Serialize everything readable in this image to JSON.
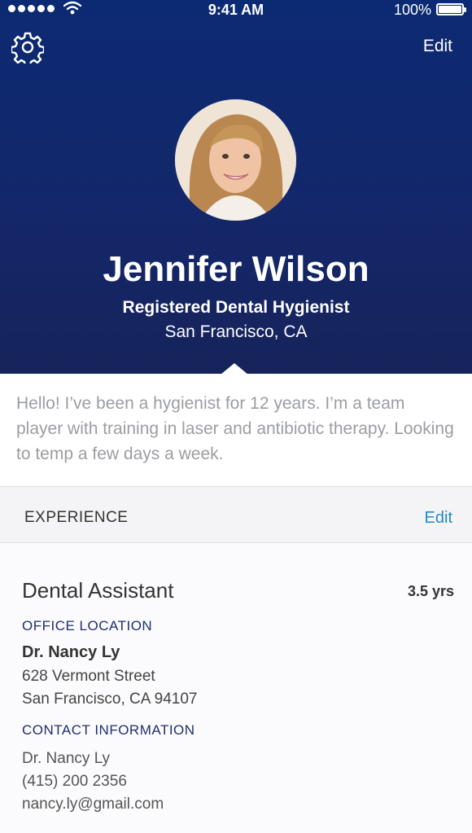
{
  "status": {
    "time": "9:41 AM",
    "battery": "100%"
  },
  "header": {
    "edit_label": "Edit",
    "name": "Jennifer Wilson",
    "title": "Registered Dental Hygienist",
    "location": "San Francisco, CA"
  },
  "bio": "Hello! I’ve been a hygienist for 12 years. I’m a team player with training in laser and antibiotic therapy. Looking to temp a few days a week.",
  "experience": {
    "section_title": "EXPERIENCE",
    "edit_label": "Edit",
    "job_title": "Dental Assistant",
    "duration": "3.5 yrs",
    "office_label": "OFFICE LOCATION",
    "office_name": "Dr. Nancy Ly",
    "address_line1": "628 Vermont Street",
    "address_line2": "San Francisco, CA 94107",
    "contact_label": "CONTACT INFORMATION",
    "contact_name": "Dr. Nancy Ly",
    "contact_phone": "(415) 200 2356",
    "contact_email": "nancy.ly@gmail.com"
  },
  "icons": [
    "signal-dots-icon",
    "wifi-icon",
    "battery-icon",
    "gear-icon"
  ],
  "colors": {
    "header_top": "#0c2a73",
    "header_bottom": "#17235b",
    "accent_link": "#1f8ac9",
    "section_label": "#1f2f6b"
  }
}
